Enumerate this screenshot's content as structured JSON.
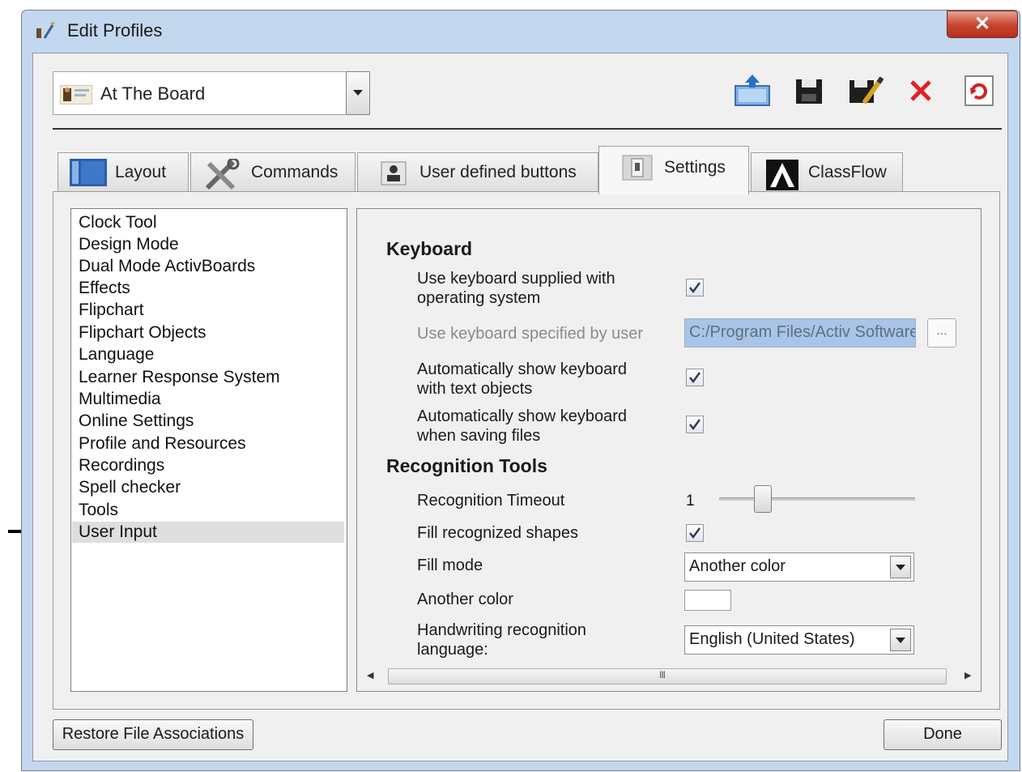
{
  "window": {
    "title": "Edit Profiles",
    "close_glyph": "✕"
  },
  "profile": {
    "selected": "At The Board"
  },
  "toolbar": {
    "icons": [
      "export-profile-icon",
      "save-icon",
      "save-as-icon",
      "delete-icon",
      "refresh-icon"
    ]
  },
  "tabs": [
    {
      "label": "Layout",
      "icon": "layout-icon"
    },
    {
      "label": "Commands",
      "icon": "commands-icon"
    },
    {
      "label": "User defined buttons",
      "icon": "user-buttons-icon"
    },
    {
      "label": "Settings",
      "icon": "settings-icon",
      "active": true
    },
    {
      "label": "ClassFlow",
      "icon": "classflow-icon"
    }
  ],
  "categories": [
    "Clock Tool",
    "Design Mode",
    "Dual Mode ActivBoards",
    "Effects",
    "Flipchart",
    "Flipchart Objects",
    "Language",
    "Learner Response System",
    "Multimedia",
    "Online Settings",
    "Profile and Resources",
    "Recordings",
    "Spell checker",
    "Tools",
    "User Input"
  ],
  "selected_category": "User Input",
  "keyboard": {
    "title": "Keyboard",
    "use_os_keyboard_l1": "Use keyboard supplied with",
    "use_os_keyboard_l2": "operating system",
    "use_os_keyboard_checked": true,
    "user_keyboard_label": "Use keyboard specified by user",
    "user_keyboard_path": "C:/Program Files/Activ Software",
    "browse_label": "...",
    "auto_text_l1": "Automatically show keyboard",
    "auto_text_l2": "with text objects",
    "auto_text_checked": true,
    "auto_save_l1": "Automatically show keyboard",
    "auto_save_l2": "when saving files",
    "auto_save_checked": true
  },
  "recognition": {
    "title": "Recognition Tools",
    "timeout_label": "Recognition Timeout",
    "timeout_value": "1",
    "fill_shapes_label": "Fill recognized shapes",
    "fill_shapes_checked": true,
    "fill_mode_label": "Fill mode",
    "fill_mode_value": "Another color",
    "another_color_label": "Another color",
    "another_color_value": "#ffffff",
    "hw_lang_l1": "Handwriting recognition",
    "hw_lang_l2": "language:",
    "hw_lang_value": "English (United States)"
  },
  "scrollbar": {
    "grip": "III",
    "left_arrow": "◀",
    "right_arrow": "▶"
  },
  "buttons": {
    "restore": "Restore File Associations",
    "done": "Done"
  },
  "colors": {
    "window_frame": "#c3d7ee",
    "dialog_bg": "#f0f0f0",
    "selected_row": "#dedede",
    "disabled_field": "#a9c4e6",
    "delete_red": "#e02020"
  }
}
